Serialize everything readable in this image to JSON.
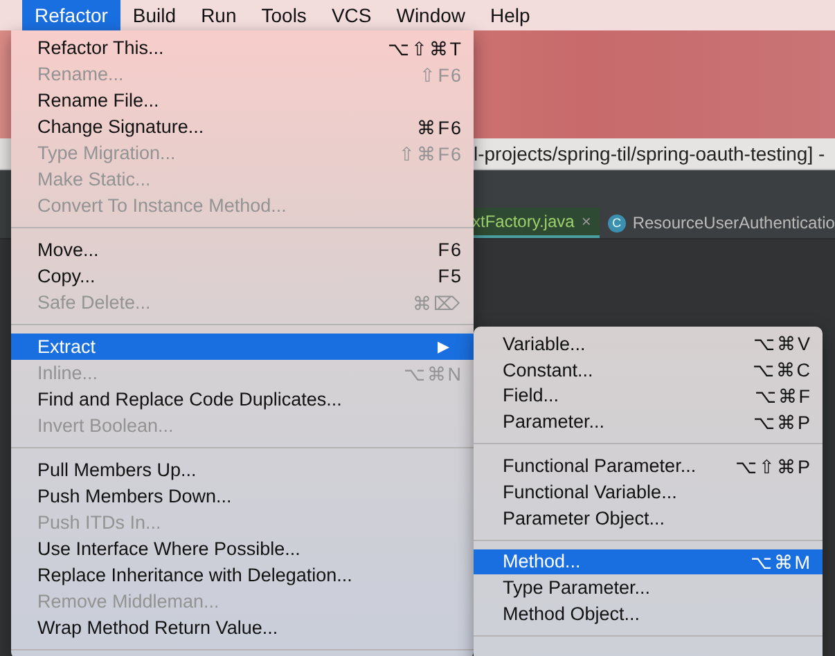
{
  "menu_bar": [
    {
      "label": "Refactor",
      "selected": true
    },
    {
      "label": "Build",
      "selected": false
    },
    {
      "label": "Run",
      "selected": false
    },
    {
      "label": "Tools",
      "selected": false
    },
    {
      "label": "VCS",
      "selected": false
    },
    {
      "label": "Window",
      "selected": false
    },
    {
      "label": "Help",
      "selected": false
    }
  ],
  "ide_window": {
    "title": "l-projects/spring-til/spring-oauth-testing] -",
    "tabs": [
      {
        "label": "xtFactory.java",
        "close": "×",
        "selected": true
      },
      {
        "label": "ResourceUserAuthenticatio",
        "icon_letter": "C",
        "selected": false
      }
    ]
  },
  "refactor_menu": [
    {
      "kind": "item",
      "label": "Refactor This...",
      "shortcut": "⌥⇧⌘T",
      "disabled": false,
      "selected": false
    },
    {
      "kind": "item",
      "label": "Rename...",
      "shortcut": "⇧F6",
      "disabled": true,
      "selected": false
    },
    {
      "kind": "item",
      "label": "Rename File...",
      "disabled": false,
      "selected": false
    },
    {
      "kind": "item",
      "label": "Change Signature...",
      "shortcut": "⌘F6",
      "disabled": false,
      "selected": false
    },
    {
      "kind": "item",
      "label": "Type Migration...",
      "shortcut": "⇧⌘F6",
      "disabled": true,
      "selected": false
    },
    {
      "kind": "item",
      "label": "Make Static...",
      "disabled": true,
      "selected": false
    },
    {
      "kind": "item",
      "label": "Convert To Instance Method...",
      "disabled": true,
      "selected": false
    },
    {
      "kind": "separator"
    },
    {
      "kind": "item",
      "label": "Move...",
      "shortcut": "F6",
      "disabled": false,
      "selected": false
    },
    {
      "kind": "item",
      "label": "Copy...",
      "shortcut": "F5",
      "disabled": false,
      "selected": false
    },
    {
      "kind": "item",
      "label": "Safe Delete...",
      "shortcut": "⌘⌦",
      "disabled": true,
      "selected": false
    },
    {
      "kind": "separator"
    },
    {
      "kind": "submenu",
      "label": "Extract",
      "arrow": "▶",
      "disabled": false,
      "selected": true
    },
    {
      "kind": "item",
      "label": "Inline...",
      "shortcut": "⌥⌘N",
      "disabled": true,
      "selected": false
    },
    {
      "kind": "item",
      "label": "Find and Replace Code Duplicates...",
      "disabled": false,
      "selected": false
    },
    {
      "kind": "item",
      "label": "Invert Boolean...",
      "disabled": true,
      "selected": false
    },
    {
      "kind": "separator"
    },
    {
      "kind": "item",
      "label": "Pull Members Up...",
      "disabled": false,
      "selected": false
    },
    {
      "kind": "item",
      "label": "Push Members Down...",
      "disabled": false,
      "selected": false
    },
    {
      "kind": "item",
      "label": "Push ITDs In...",
      "disabled": true,
      "selected": false
    },
    {
      "kind": "item",
      "label": "Use Interface Where Possible...",
      "disabled": false,
      "selected": false
    },
    {
      "kind": "item",
      "label": "Replace Inheritance with Delegation...",
      "disabled": false,
      "selected": false
    },
    {
      "kind": "item",
      "label": "Remove Middleman...",
      "disabled": true,
      "selected": false
    },
    {
      "kind": "item",
      "label": "Wrap Method Return Value...",
      "disabled": false,
      "selected": false
    },
    {
      "kind": "separator"
    }
  ],
  "extract_submenu": [
    {
      "kind": "item",
      "label": "Variable...",
      "shortcut": "⌥⌘V",
      "selected": false
    },
    {
      "kind": "item",
      "label": "Constant...",
      "shortcut": "⌥⌘C",
      "selected": false
    },
    {
      "kind": "item",
      "label": "Field...",
      "shortcut": "⌥⌘F",
      "selected": false
    },
    {
      "kind": "item",
      "label": "Parameter...",
      "shortcut": "⌥⌘P",
      "selected": false
    },
    {
      "kind": "separator"
    },
    {
      "kind": "item",
      "label": "Functional Parameter...",
      "shortcut": "⌥⇧⌘P",
      "selected": false
    },
    {
      "kind": "item",
      "label": "Functional Variable...",
      "selected": false
    },
    {
      "kind": "item",
      "label": "Parameter Object...",
      "selected": false
    },
    {
      "kind": "separator"
    },
    {
      "kind": "item",
      "label": "Method...",
      "shortcut": "⌥⌘M",
      "selected": true
    },
    {
      "kind": "item",
      "label": "Type Parameter...",
      "selected": false
    },
    {
      "kind": "item",
      "label": "Method Object...",
      "selected": false
    },
    {
      "kind": "separator"
    }
  ]
}
